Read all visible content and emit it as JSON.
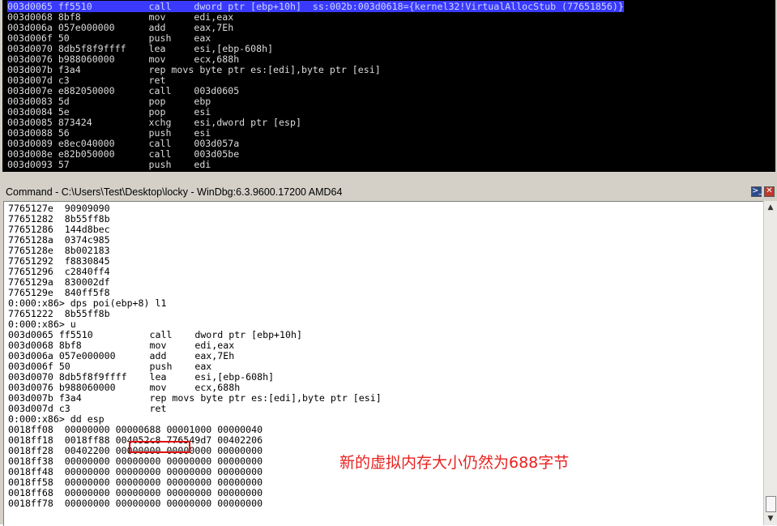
{
  "disassembly": {
    "lines": [
      "003d0065 ff5510          call    dword ptr [ebp+10h]  ss:002b:003d0618={kernel32!VirtualAllocStub (77651856)}",
      "003d0068 8bf8            mov     edi,eax",
      "003d006a 057e000000      add     eax,7Eh",
      "003d006f 50              push    eax",
      "003d0070 8db5f8f9ffff    lea     esi,[ebp-608h]",
      "003d0076 b988060000      mov     ecx,688h",
      "003d007b f3a4            rep movs byte ptr es:[edi],byte ptr [esi]",
      "003d007d c3              ret",
      "003d007e e882050000      call    003d0605",
      "003d0083 5d              pop     ebp",
      "003d0084 5e              pop     esi",
      "003d0085 873424          xchg    esi,dword ptr [esp]",
      "003d0088 56              push    esi",
      "003d0089 e8ec040000      call    003d057a",
      "003d008e e82b050000      call    003d05be",
      "003d0093 57              push    edi"
    ]
  },
  "command_window": {
    "title": "Command - C:\\Users\\Test\\Desktop\\locky - WinDbg:6.3.9600.17200 AMD64",
    "output_lines": [
      "7765127e  90909090",
      "77651282  8b55ff8b",
      "77651286  144d8bec",
      "7765128a  0374c985",
      "7765128e  8b002183",
      "77651292  f8830845",
      "77651296  c2840ff4",
      "7765129a  830002df",
      "7765129e  840ff5f8",
      "0:000:x86> dps poi(ebp+8) l1",
      "77651222  8b55ff8b",
      "0:000:x86> u",
      "003d0065 ff5510          call    dword ptr [ebp+10h]",
      "003d0068 8bf8            mov     edi,eax",
      "003d006a 057e000000      add     eax,7Eh",
      "003d006f 50              push    eax",
      "003d0070 8db5f8f9ffff    lea     esi,[ebp-608h]",
      "003d0076 b988060000      mov     ecx,688h",
      "003d007b f3a4            rep movs byte ptr es:[edi],byte ptr [esi]",
      "003d007d c3              ret",
      "0:000:x86> dd esp",
      "0018ff08  00000000 00000688 00001000 00000040",
      "0018ff18  0018ff88 004052c8 776549d7 00402206",
      "0018ff28  00402200 00000000 00000000 00000000",
      "0018ff38  00000000 00000000 00000000 00000000",
      "0018ff48  00000000 00000000 00000000 00000000",
      "0018ff58  00000000 00000000 00000000 00000000",
      "0018ff68  00000000 00000000 00000000 00000000",
      "0018ff78  00000000 00000000 00000000 00000000"
    ]
  },
  "annotation": {
    "text": "新的虚拟内存大小仍然为688字节",
    "color": "#e8221f"
  },
  "colors": {
    "selection": "#3a3aff",
    "disasm_bg": "#000000",
    "highlight_box": "#e01010"
  },
  "icons": {
    "cmd_button": "command-prompt-icon",
    "close_button": "close-icon",
    "scroll_up": "scroll-up-arrow-icon",
    "scroll_down": "scroll-down-arrow-icon"
  }
}
